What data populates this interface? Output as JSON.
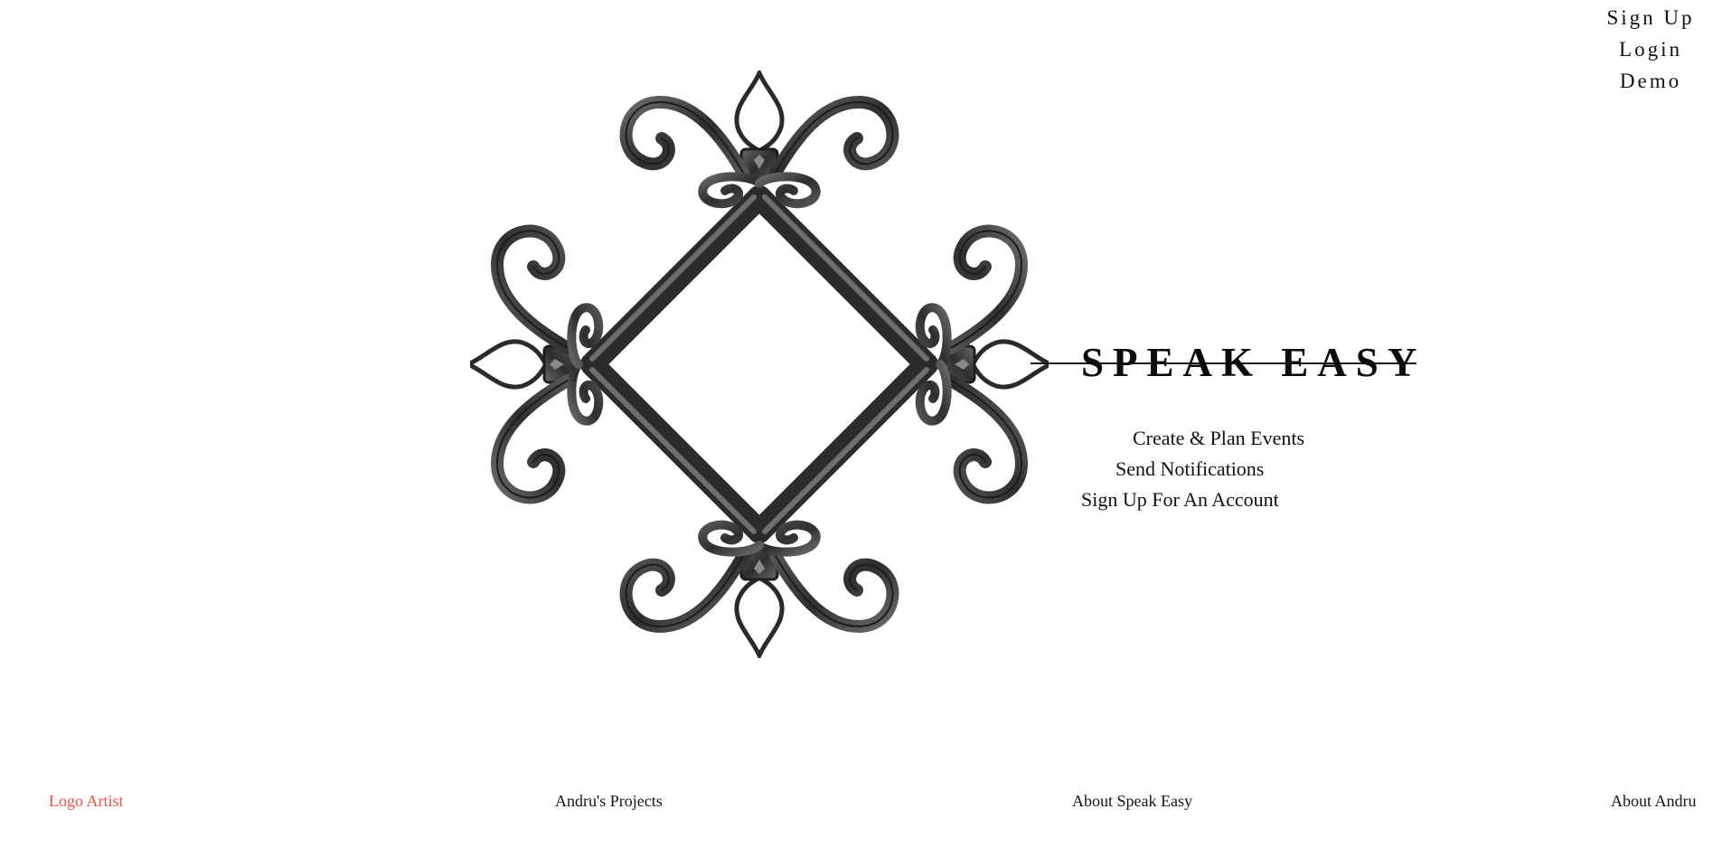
{
  "auth_nav": {
    "sign_up": "Sign Up",
    "login": "Login",
    "demo": "Demo"
  },
  "logo": {
    "icon": "wrought-iron-ornament-icon",
    "color": "#3a3a3a"
  },
  "brand": {
    "title": "SPEAK EASY"
  },
  "features": [
    "Create & Plan Events",
    "Send Notifications",
    "Sign Up For An Account"
  ],
  "footer": {
    "logo_artist": "Logo Artist",
    "projects": "Andru's Projects",
    "about_app": "About Speak Easy",
    "about_author": "About Andru"
  },
  "colors": {
    "accent": "#e8524a",
    "text": "#111111",
    "background": "#ffffff"
  }
}
